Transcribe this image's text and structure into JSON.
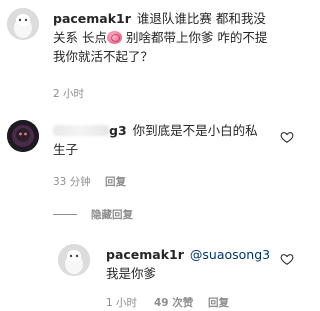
{
  "comments": [
    {
      "username": "pacemak1r",
      "text_before_emoji": "谁退队谁比赛 都和我没关系 长点",
      "text_after_emoji": " 别啥都带上你爹 咋的不提我你就活不起了？",
      "time": "2 小时",
      "emoji": "anatomical-heart-brain-emoji"
    },
    {
      "username_visible": "g3",
      "text": "你到底是不是小白的私生子",
      "time": "33 分钟",
      "reply_label": "回复"
    }
  ],
  "hidden_replies": {
    "label": "隐藏回复"
  },
  "reply": {
    "username": "pacemak1r",
    "mention": "@suaosong3",
    "text": "我是你爹",
    "time": "1 小时",
    "likes": "49 次赞",
    "reply_label": "回复"
  },
  "icons": {
    "avatar_1": "white-dog-avatar",
    "avatar_2": "dark-figure-avatar",
    "avatar_3": "white-dog-avatar",
    "like": "heart-icon"
  },
  "colors": {
    "text": "#262626",
    "meta": "#8e8e8e",
    "mention": "#00376b"
  }
}
